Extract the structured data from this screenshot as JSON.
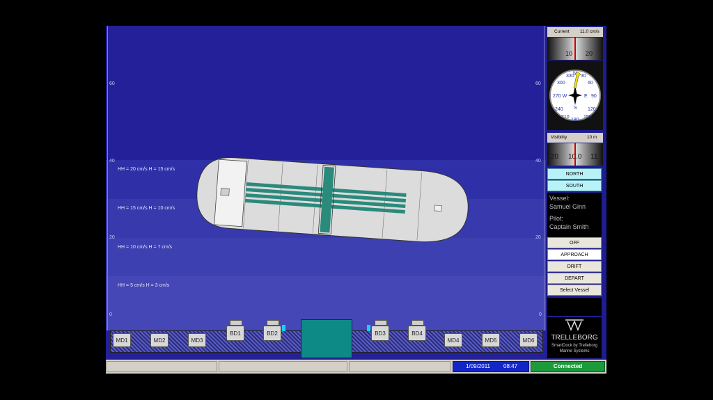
{
  "ruler": {
    "left_ticks": [
      "60",
      "40",
      "20",
      "0"
    ],
    "right_ticks": [
      "60",
      "40",
      "20",
      "0"
    ]
  },
  "zones": [
    {
      "label": "HH = 20 cm/s   H = 15 cm/s"
    },
    {
      "label": "HH = 15 cm/s   H = 10 cm/s"
    },
    {
      "label": "HH = 10 cm/s   H = 7 cm/s"
    },
    {
      "label": "HH = 5 cm/s   H = 3 cm/s"
    }
  ],
  "fenders": [
    "MD1",
    "MD2",
    "MD3",
    "MD4",
    "MD5",
    "MD6"
  ],
  "bollards": [
    "BD1",
    "BD2",
    "BD3",
    "BD4"
  ],
  "current": {
    "label": "Current",
    "value": "11.0 cm/s",
    "scale": [
      "10",
      "20"
    ]
  },
  "compass": {
    "labels": [
      "330",
      "N",
      "30",
      "300",
      "60",
      "270 W",
      "E",
      "90",
      "240",
      "120",
      "210",
      "S",
      "150",
      "180"
    ]
  },
  "visibility": {
    "label": "Visibility",
    "value": "10 m",
    "scale": [
      "20",
      "10.0",
      "11"
    ]
  },
  "direction": {
    "north": "NORTH",
    "south": "SOUTH"
  },
  "vessel": {
    "vessel_label": "Vessel:",
    "vessel_name": "Samuel Ginn",
    "pilot_label": "Pilot:",
    "pilot_name": "Captain Smith"
  },
  "modes": {
    "off": "OFF",
    "approach": "APPROACH",
    "drift": "DRIFT",
    "depart": "DEPART",
    "select": "Select Vessel"
  },
  "brand": {
    "name": "TRELLEBORG",
    "tagline1": "SmartDock by Trelleborg",
    "tagline2": "Marine Systems"
  },
  "status": {
    "date": "1/09/2011",
    "time": "08:47",
    "connection": "Connected"
  },
  "colors": {
    "water": "#23209a",
    "connected": "#1c9a3c",
    "datebar": "#1226c8"
  }
}
